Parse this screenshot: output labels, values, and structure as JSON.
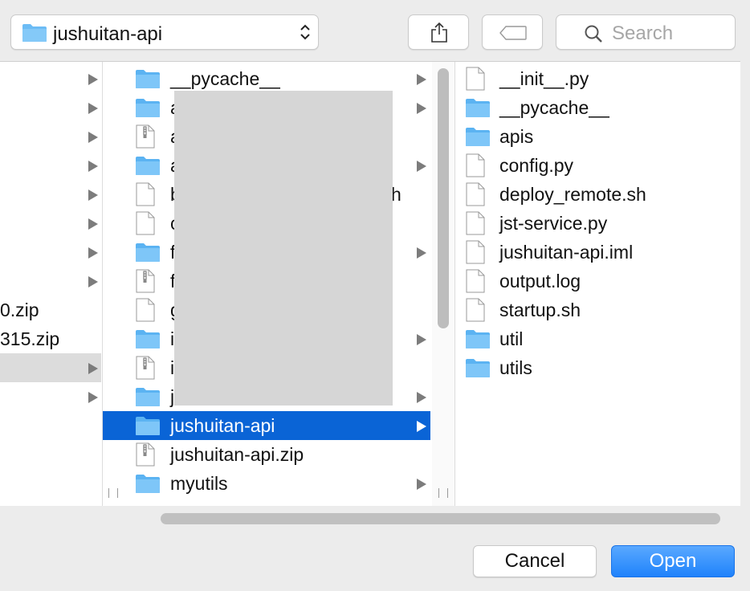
{
  "toolbar": {
    "path_label": "jushuitan-api",
    "search_placeholder": "Search"
  },
  "column1": {
    "rows": [
      {
        "label": "",
        "arrow": true
      },
      {
        "label": "",
        "arrow": true
      },
      {
        "label": "",
        "arrow": true
      },
      {
        "label": "",
        "arrow": true
      },
      {
        "label": "",
        "arrow": true
      },
      {
        "label": "",
        "arrow": true
      },
      {
        "label": "",
        "arrow": true
      },
      {
        "label": "",
        "arrow": true
      },
      {
        "label": "0.zip",
        "arrow": false
      },
      {
        "label": "315.zip",
        "arrow": false
      },
      {
        "label": "",
        "arrow": true,
        "selected": true
      },
      {
        "label": "",
        "arrow": true
      }
    ]
  },
  "column2": {
    "rows": [
      {
        "label": "__pycache__",
        "type": "folder",
        "arrow": true
      },
      {
        "label": "a",
        "type": "folder",
        "arrow": true
      },
      {
        "label": "a",
        "type": "zip",
        "arrow": false
      },
      {
        "label": "a",
        "type": "folder",
        "arrow": true
      },
      {
        "label": "b",
        "type": "file",
        "arrow": false,
        "tail": "h"
      },
      {
        "label": "c",
        "type": "file",
        "arrow": false
      },
      {
        "label": "f",
        "type": "folder",
        "arrow": true
      },
      {
        "label": "f",
        "type": "zip",
        "arrow": false
      },
      {
        "label": "g",
        "type": "file",
        "arrow": false
      },
      {
        "label": "i",
        "type": "folder",
        "arrow": true
      },
      {
        "label": "i",
        "type": "zip",
        "arrow": false
      },
      {
        "label": "j",
        "type": "folder",
        "arrow": true
      },
      {
        "label": "jushuitan-api",
        "type": "folder",
        "arrow": true,
        "selected": true
      },
      {
        "label": "jushuitan-api.zip",
        "type": "zip",
        "arrow": false
      },
      {
        "label": "myutils",
        "type": "folder",
        "arrow": true
      }
    ]
  },
  "column3": {
    "rows": [
      {
        "label": "__init__.py",
        "type": "file"
      },
      {
        "label": "__pycache__",
        "type": "folder"
      },
      {
        "label": "apis",
        "type": "folder"
      },
      {
        "label": "config.py",
        "type": "file"
      },
      {
        "label": "deploy_remote.sh",
        "type": "file"
      },
      {
        "label": "jst-service.py",
        "type": "file"
      },
      {
        "label": "jushuitan-api.iml",
        "type": "file"
      },
      {
        "label": "output.log",
        "type": "file"
      },
      {
        "label": "startup.sh",
        "type": "file"
      },
      {
        "label": "util",
        "type": "folder"
      },
      {
        "label": "utils",
        "type": "folder"
      }
    ]
  },
  "buttons": {
    "cancel": "Cancel",
    "open": "Open"
  },
  "colors": {
    "selection": "#0a64d6",
    "folder": "#6cbcf5",
    "primary_button": "#1f82fb"
  }
}
